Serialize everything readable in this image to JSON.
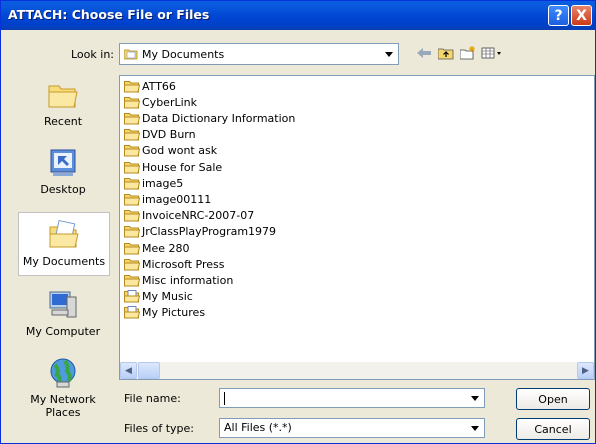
{
  "window": {
    "title": "ATTACH: Choose File or Files",
    "help_label": "?",
    "close_label": "X"
  },
  "lookin": {
    "label": "Look in:",
    "value": "My Documents"
  },
  "places": [
    {
      "label": "Recent",
      "icon": "recent-folder-icon"
    },
    {
      "label": "Desktop",
      "icon": "desktop-icon"
    },
    {
      "label": "My Documents",
      "icon": "my-documents-icon"
    },
    {
      "label": "My Computer",
      "icon": "my-computer-icon"
    },
    {
      "label": "My Network Places",
      "icon": "network-places-icon"
    }
  ],
  "files": [
    {
      "name": "ATT66",
      "type": "folder"
    },
    {
      "name": "CyberLink",
      "type": "folder"
    },
    {
      "name": "Data Dictionary Information",
      "type": "folder"
    },
    {
      "name": "DVD Burn",
      "type": "folder"
    },
    {
      "name": "God wont ask",
      "type": "folder"
    },
    {
      "name": "House for Sale",
      "type": "folder"
    },
    {
      "name": "image5",
      "type": "folder"
    },
    {
      "name": "image00111",
      "type": "folder"
    },
    {
      "name": "InvoiceNRC-2007-07",
      "type": "folder"
    },
    {
      "name": "JrClassPlayProgram1979",
      "type": "folder"
    },
    {
      "name": "Mee 280",
      "type": "folder"
    },
    {
      "name": "Microsoft Press",
      "type": "folder"
    },
    {
      "name": "Misc information",
      "type": "folder"
    },
    {
      "name": "My Music",
      "type": "special-folder"
    },
    {
      "name": "My Pictures",
      "type": "special-folder"
    }
  ],
  "filename": {
    "label": "File name:",
    "value": ""
  },
  "filetype": {
    "label": "Files of type:",
    "value": "All Files (*.*)"
  },
  "buttons": {
    "open": "Open",
    "cancel": "Cancel"
  },
  "colors": {
    "titlebar": "#0046d4",
    "folder": "#f4d66e",
    "window_bg": "#ece9d8"
  }
}
